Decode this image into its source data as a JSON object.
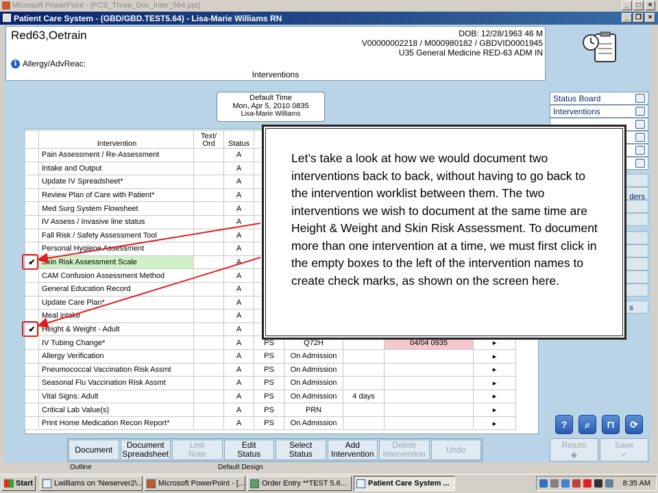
{
  "ppt_window": {
    "title": "Microsoft PowerPoint - [PCS_Three_Doc_Inter_564.ppt]"
  },
  "app_window": {
    "title": "Patient Care System - (GBD/GBD.TEST5.64) - Lisa-Marie Williams RN"
  },
  "patient": {
    "name": "Red63,Oetrain",
    "dob": "DOB: 12/28/1963 46 M",
    "ids": "V00000002218 / M000980182 / GBDVID0001945",
    "location": "U35 General Medicine  RED-63  ADM IN",
    "allergy_label": "Allergy/AdvReac:"
  },
  "panel_title": "Interventions",
  "default_time": {
    "label": "Default Time",
    "value": "Mon, Apr 5, 2010  0835",
    "user": "Lisa-Marie Williams"
  },
  "grid": {
    "headers": {
      "intervention": "Intervention",
      "text_ord": "Text/\nOrd",
      "status": "Status"
    },
    "rows": [
      {
        "check": "",
        "name": "Pain Assessment / Re-Assessment",
        "status": "A",
        "src": "",
        "freq": "",
        "due": "",
        "last": "",
        "arrow": ""
      },
      {
        "check": "",
        "name": "Intake and Output",
        "status": "A",
        "src": "",
        "freq": "",
        "due": "",
        "last": "",
        "arrow": ""
      },
      {
        "check": "",
        "name": "Update IV Spreadsheet*",
        "status": "A",
        "src": "",
        "freq": "",
        "due": "",
        "last": "",
        "arrow": ""
      },
      {
        "check": "",
        "name": "Review Plan of Care with Patient*",
        "status": "A",
        "src": "",
        "freq": "",
        "due": "",
        "last": "",
        "arrow": ""
      },
      {
        "check": "",
        "name": "Med Surg System Flowsheet",
        "status": "A",
        "src": "",
        "freq": "",
        "due": "",
        "last": "",
        "arrow": ""
      },
      {
        "check": "",
        "name": "IV Assess / Invasive line status",
        "status": "A",
        "src": "",
        "freq": "",
        "due": "",
        "last": "",
        "arrow": ""
      },
      {
        "check": "",
        "name": "Fall Risk / Safety Assessment Tool",
        "status": "A",
        "src": "",
        "freq": "",
        "due": "",
        "last": "",
        "arrow": ""
      },
      {
        "check": "",
        "name": "Personal Hygiene Assessment",
        "status": "A",
        "src": "",
        "freq": "",
        "due": "",
        "last": "",
        "arrow": ""
      },
      {
        "check": "✔",
        "name": "Skin Risk Assessment Scale",
        "status": "A",
        "src": "",
        "freq": "",
        "due": "",
        "last": "",
        "arrow": "",
        "highlight": true
      },
      {
        "check": "",
        "name": "CAM Confusion Assessment Method",
        "status": "A",
        "src": "",
        "freq": "",
        "due": "",
        "last": "",
        "arrow": ""
      },
      {
        "check": "",
        "name": "General Education Record",
        "status": "A",
        "src": "",
        "freq": "",
        "due": "",
        "last": "",
        "arrow": ""
      },
      {
        "check": "",
        "name": "Update Care Plan*",
        "status": "A",
        "src": "",
        "freq": "",
        "due": "",
        "last": "",
        "arrow": ""
      },
      {
        "check": "",
        "name": "Meal intake",
        "status": "A",
        "src": "",
        "freq": "",
        "due": "",
        "last": "",
        "arrow": ""
      },
      {
        "check": "✔",
        "name": "Height & Weight - Adult",
        "status": "A",
        "src": "",
        "freq": "",
        "due": "",
        "last": "",
        "arrow": ""
      },
      {
        "check": "",
        "name": "IV Tubing Change*",
        "status": "A",
        "src": "PS",
        "freq": "Q72H",
        "due": "",
        "last": "04/04 0935",
        "arrow": "▸",
        "last_red": true
      },
      {
        "check": "",
        "name": "Allergy Verification",
        "status": "A",
        "src": "PS",
        "freq": "On Admission",
        "due": "",
        "last": "",
        "arrow": "▸"
      },
      {
        "check": "",
        "name": "Pneumococcal Vaccination Risk Assmt",
        "status": "A",
        "src": "PS",
        "freq": "On Admission",
        "due": "",
        "last": "",
        "arrow": "▸"
      },
      {
        "check": "",
        "name": "Seasonal Flu Vaccination Risk Assmt",
        "status": "A",
        "src": "PS",
        "freq": "On Admission",
        "due": "",
        "last": "",
        "arrow": "▸"
      },
      {
        "check": "",
        "name": "Vital Signs: Adult",
        "status": "A",
        "src": "PS",
        "freq": "On Admission",
        "due": "4 days",
        "last": "",
        "arrow": "▸"
      },
      {
        "check": "",
        "name": "Critical Lab Value(s)",
        "status": "A",
        "src": "PS",
        "freq": "PRN",
        "due": "",
        "last": "",
        "arrow": "▸"
      },
      {
        "check": "",
        "name": "Print Home Medication Recon Report*",
        "status": "A",
        "src": "PS",
        "freq": "On Admission",
        "due": "",
        "last": "",
        "arrow": "▸"
      }
    ]
  },
  "callout": {
    "text": "Let’s take a look at how we would document two interventions back to back, without having to go back to the intervention worklist between them. The two interventions we wish to document at the same time are Height & Weight and Skin Risk Assessment. To document more than one intervention at a time, we must first click in the empty boxes to the left of the intervention names to create check marks, as shown on the screen here."
  },
  "side_nav": {
    "items": [
      {
        "label": "Status Board",
        "icon": "book-icon"
      },
      {
        "label": "Interventions",
        "icon": "stethoscope-icon"
      }
    ],
    "partial_texts": {
      "ders": "ders",
      "s": "s"
    }
  },
  "actions": [
    {
      "label": "Document",
      "enabled": true
    },
    {
      "label": "Document\nSpreadsheet",
      "enabled": true
    },
    {
      "label": "Link\nNote",
      "enabled": false
    },
    {
      "label": "Edit\nStatus",
      "enabled": true
    },
    {
      "label": "Select\nStatus",
      "enabled": true
    },
    {
      "label": "Add\nIntervention",
      "enabled": true
    },
    {
      "label": "Delete\nIntervention",
      "enabled": false
    },
    {
      "label": "Undo",
      "enabled": false
    }
  ],
  "nav_buttons": [
    {
      "label": "Return",
      "glyph": "◆"
    },
    {
      "label": "Save",
      "glyph": "✓"
    }
  ],
  "ppt_status": {
    "left": "Outline",
    "right": "Default Design"
  },
  "taskbar": {
    "start": "Start",
    "buttons": [
      "Lwilliams on 'Nwserver2\\...",
      "Microsoft PowerPoint - [...",
      "Order Entry **TEST 5.6...",
      "Patient Care System ..."
    ],
    "clock": "8:35 AM"
  }
}
